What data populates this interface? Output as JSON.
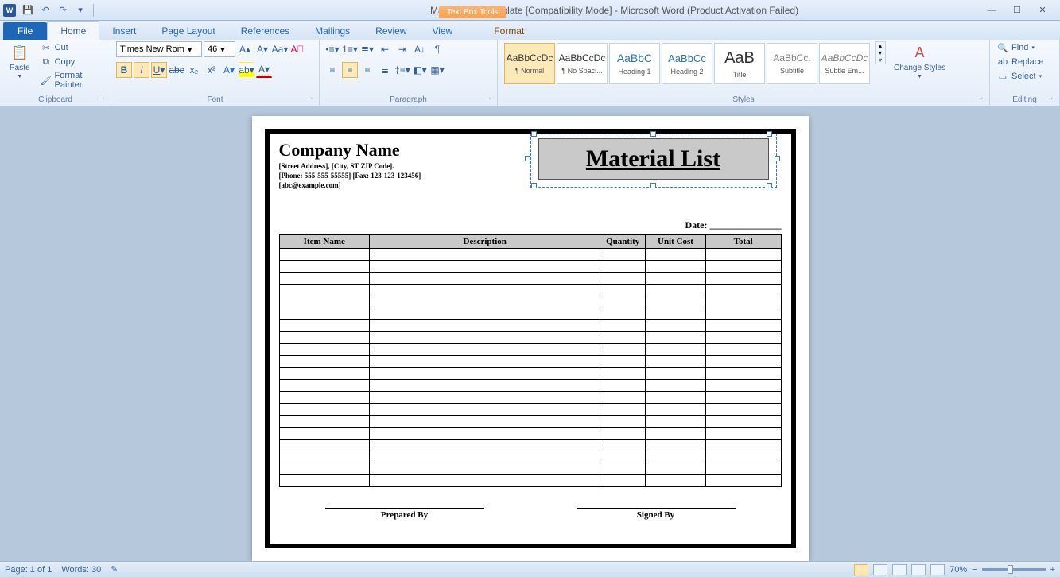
{
  "window": {
    "title": "Material List Template [Compatibility Mode]  -  Microsoft Word (Product Activation Failed)",
    "contextTabGroup": "Text Box Tools"
  },
  "tabs": {
    "file": "File",
    "items": [
      "Home",
      "Insert",
      "Page Layout",
      "References",
      "Mailings",
      "Review",
      "View"
    ],
    "context": "Format",
    "active": "Home"
  },
  "ribbon": {
    "clipboard": {
      "label": "Clipboard",
      "paste": "Paste",
      "cut": "Cut",
      "copy": "Copy",
      "formatPainter": "Format Painter"
    },
    "font": {
      "label": "Font",
      "name": "Times New Rom",
      "size": "46"
    },
    "paragraph": {
      "label": "Paragraph"
    },
    "styles": {
      "label": "Styles",
      "items": [
        {
          "preview": "AaBbCcDc",
          "name": "¶ Normal",
          "sel": true
        },
        {
          "preview": "AaBbCcDc",
          "name": "¶ No Spaci..."
        },
        {
          "preview": "AaBbC",
          "name": "Heading 1"
        },
        {
          "preview": "AaBbCc",
          "name": "Heading 2"
        },
        {
          "preview": "AaB",
          "name": "Title"
        },
        {
          "preview": "AaBbCc.",
          "name": "Subtitle"
        },
        {
          "preview": "AaBbCcDc",
          "name": "Subtle Em..."
        }
      ],
      "changeStyles": "Change Styles"
    },
    "editing": {
      "label": "Editing",
      "find": "Find",
      "replace": "Replace",
      "select": "Select"
    }
  },
  "document": {
    "companyName": "Company Name",
    "addr": "[Street Address], [City, ST ZIP Code].",
    "phone": "[Phone: 555-555-55555] [Fax: 123-123-123456]",
    "email": "[abc@example.com]",
    "titleBox": "Material List",
    "dateLabel": "Date: _______________",
    "headers": [
      "Item Name",
      "Description",
      "Quantity",
      "Unit Cost",
      "Total"
    ],
    "rows": 20,
    "preparedBy": "Prepared  By",
    "signedBy": "Signed By"
  },
  "status": {
    "page": "Page: 1 of 1",
    "words": "Words: 30",
    "zoom": "70%"
  }
}
